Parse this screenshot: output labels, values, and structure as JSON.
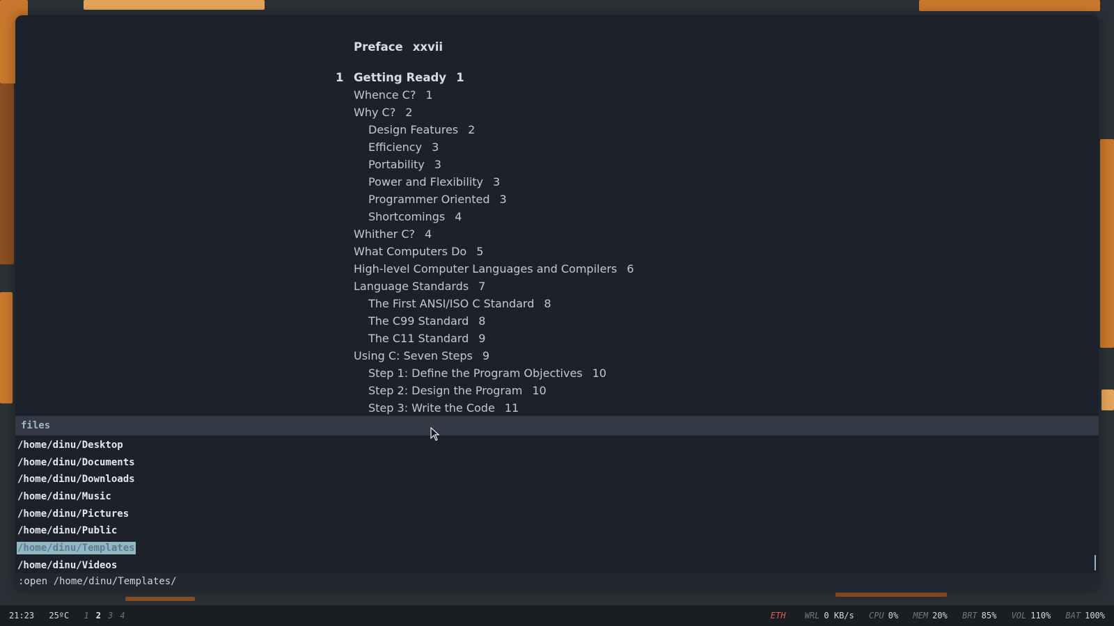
{
  "toc": {
    "preface": {
      "title": "Preface",
      "page": "xxvii"
    },
    "chapter": {
      "number": "1",
      "title": "Getting Ready",
      "page": "1"
    },
    "entries": [
      {
        "title": "Whence C?",
        "page": "1",
        "level": 1
      },
      {
        "title": "Why C?",
        "page": "2",
        "level": 1
      },
      {
        "title": "Design Features",
        "page": "2",
        "level": 2
      },
      {
        "title": "Efficiency",
        "page": "3",
        "level": 2
      },
      {
        "title": "Portability",
        "page": "3",
        "level": 2
      },
      {
        "title": "Power and Flexibility",
        "page": "3",
        "level": 2
      },
      {
        "title": "Programmer Oriented",
        "page": "3",
        "level": 2
      },
      {
        "title": "Shortcomings",
        "page": "4",
        "level": 2
      },
      {
        "title": "Whither C?",
        "page": "4",
        "level": 1
      },
      {
        "title": "What Computers Do",
        "page": "5",
        "level": 1
      },
      {
        "title": "High-level Computer Languages and Compilers",
        "page": "6",
        "level": 1
      },
      {
        "title": "Language Standards",
        "page": "7",
        "level": 1
      },
      {
        "title": "The First ANSI/ISO C Standard",
        "page": "8",
        "level": 2
      },
      {
        "title": "The C99 Standard",
        "page": "8",
        "level": 2
      },
      {
        "title": "The C11 Standard",
        "page": "9",
        "level": 2
      },
      {
        "title": "Using C: Seven Steps",
        "page": "9",
        "level": 1
      },
      {
        "title": "Step 1: Define the Program Objectives",
        "page": "10",
        "level": 2
      },
      {
        "title": "Step 2: Design the Program",
        "page": "10",
        "level": 2
      },
      {
        "title": "Step 3: Write the Code",
        "page": "11",
        "level": 2
      }
    ]
  },
  "completion": {
    "header": "files",
    "items": [
      "/home/dinu/Desktop",
      "/home/dinu/Documents",
      "/home/dinu/Downloads",
      "/home/dinu/Music",
      "/home/dinu/Pictures",
      "/home/dinu/Public",
      "/home/dinu/Templates",
      "/home/dinu/Videos"
    ],
    "selected_index": 6
  },
  "cmdline": {
    "value": ":open /home/dinu/Templates/"
  },
  "statusbar": {
    "time": "21:23",
    "temp": "25ºC",
    "workspaces": [
      "1",
      "2",
      "3",
      "4"
    ],
    "active_workspace": "2",
    "eth_label": "ETH",
    "wrl_label": "WRL",
    "wrl_value": "0 KB/s",
    "cpu_label": "CPU",
    "cpu_value": "0%",
    "mem_label": "MEM",
    "mem_value": "20%",
    "brt_label": "BRT",
    "brt_value": "85%",
    "vol_label": "VOL",
    "vol_value": "110%",
    "bat_label": "BAT",
    "bat_value": "100%"
  },
  "colors": {
    "window_bg": "#1d222a",
    "completion_header_bg": "#343a45",
    "selection_bg": "#8fb8c6",
    "eth_red": "#e0605a",
    "wallpaper_orange": "#c9782e"
  }
}
